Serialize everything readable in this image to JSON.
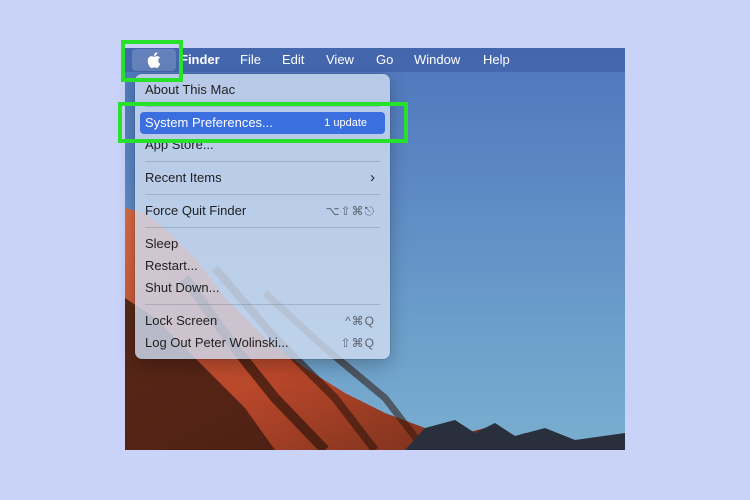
{
  "menubar": {
    "apple_icon": "apple-logo-icon",
    "items": [
      "Finder",
      "File",
      "Edit",
      "View",
      "Go",
      "Window",
      "Help"
    ]
  },
  "apple_menu": {
    "about": "About This Mac",
    "system_prefs": "System Preferences...",
    "system_prefs_badge": "1 update",
    "app_store": "App Store...",
    "recent_items": "Recent Items",
    "force_quit": "Force Quit Finder",
    "force_quit_shortcut": "⌥⇧⌘⎋",
    "sleep": "Sleep",
    "restart": "Restart...",
    "shut_down": "Shut Down...",
    "lock_screen": "Lock Screen",
    "lock_screen_shortcut": "^⌘Q",
    "log_out": "Log Out Peter Wolinski...",
    "log_out_shortcut": "⇧⌘Q"
  },
  "highlight_color": "#27e12a",
  "selected_color": "#3b6fe0"
}
